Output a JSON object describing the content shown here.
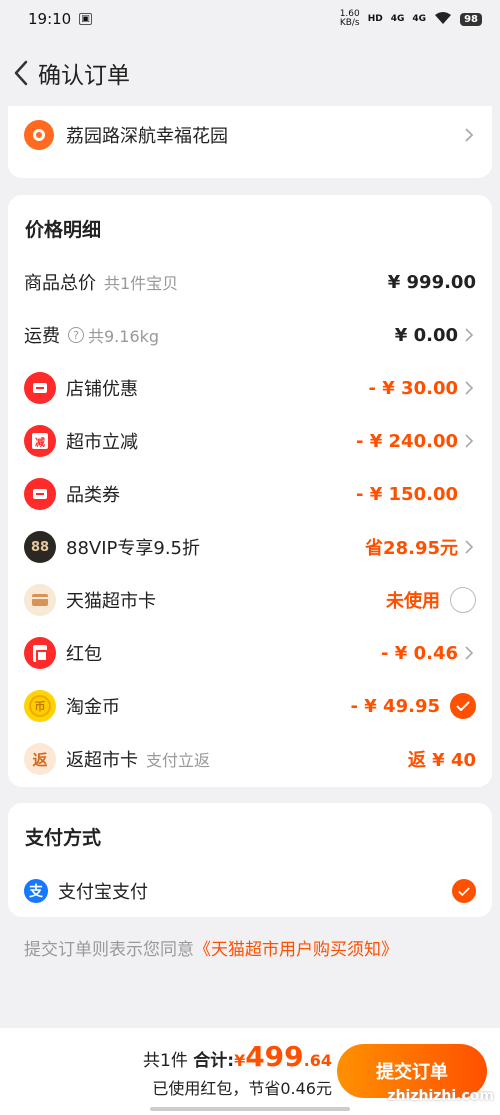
{
  "status": {
    "time": "19:10",
    "net_speed_value": "1.60",
    "net_speed_unit": "KB/s",
    "hd": "HD",
    "sig1": "4G",
    "sig2": "4G",
    "battery": "98"
  },
  "header": {
    "title": "确认订单"
  },
  "address": {
    "text": "荔园路深航幸福花园"
  },
  "price": {
    "title": "价格明细",
    "rows": [
      {
        "label": "商品总价",
        "sub": "共1件宝贝",
        "amount": "¥ 999.00"
      },
      {
        "label": "运费",
        "sub": "共9.16kg",
        "amount": "¥ 0.00"
      },
      {
        "label": "店铺优惠",
        "amount": "- ¥ 30.00"
      },
      {
        "label": "超市立减",
        "icon_text": "减",
        "amount": "- ¥ 240.00"
      },
      {
        "label": "品类券",
        "amount": "- ¥ 150.00"
      },
      {
        "label": "88VIP专享9.5折",
        "icon_text": "88",
        "amount": "省28.95元"
      },
      {
        "label": "天猫超市卡",
        "amount": "未使用"
      },
      {
        "label": "红包",
        "amount": "- ¥ 0.46"
      },
      {
        "label": "淘金币",
        "icon_text": "币",
        "amount": "- ¥ 49.95"
      },
      {
        "label": "返超市卡",
        "sub": "支付立返",
        "icon_text": "返",
        "amount": "返 ¥ 40"
      }
    ]
  },
  "payment": {
    "title": "支付方式",
    "method_icon": "支",
    "method": "支付宝支付"
  },
  "agreement": {
    "prefix": "提交订单则表示您同意",
    "link": "《天猫超市用户购买须知》"
  },
  "bottom": {
    "count": "共1件",
    "total_label": "合计:",
    "currency": "¥",
    "total_int": "499",
    "total_dec": ".64",
    "savings": "已使用红包，节省0.46元",
    "submit": "提交订单"
  },
  "colors": {
    "accent": "#ff5000",
    "alipay": "#1677ff",
    "red_icon": "#ff2a2a"
  },
  "watermark": "zhizhizhi.com"
}
